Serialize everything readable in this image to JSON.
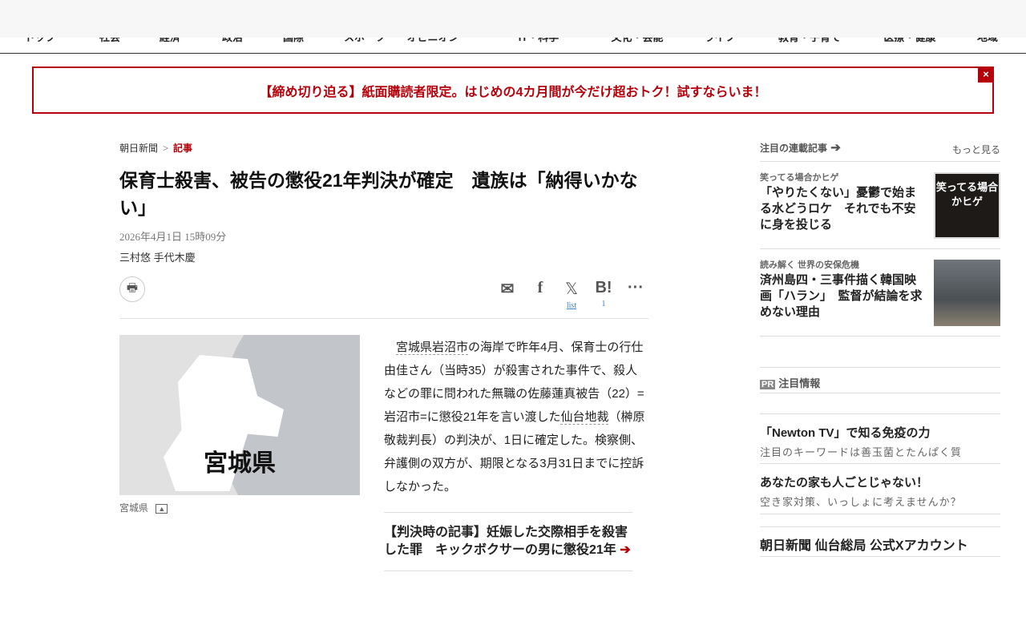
{
  "nav": [
    "トップ",
    "社会",
    "経済",
    "政治",
    "国際",
    "スポーツ",
    "オピニオン",
    "IT・科学",
    "文化・芸能",
    "ライフ",
    "教育・子育て",
    "医療・健康",
    "地域"
  ],
  "banner": {
    "text": "【締め切り迫る】紙面購読者限定。はじめの4カ月間が今だけ超おトク！試すならいま！",
    "close": "×"
  },
  "breadcrumb": {
    "home": "朝日新聞",
    "sep": ">",
    "current": "記事"
  },
  "article": {
    "title": "保育士殺害、被告の懲役21年判決が確定　遺族は「納得いかない」",
    "date": "2026年4月1日 15時09分",
    "authors": "三村悠 手代木慶",
    "share": {
      "x_count": "list",
      "hatena_count": "1"
    },
    "image_label": "宮城県",
    "caption": "宮城県",
    "body": {
      "link1": "宮城県岩沼市",
      "p1": "の海岸で昨年4月、保育士の行仕由佳さん（当時35）が殺害された事件で、殺人などの罪に問われた無職の佐藤蓮真被告（22）=岩沼市=に懲役21年を言い渡した",
      "link2": "仙台地裁",
      "p2": "（榊原敬裁判長）の判決が、1日に確定した。検察側、弁護側の双方が、期限となる3月31日までに控訴しなかった。"
    },
    "related": "【判決時の記事】妊娠した交際相手を殺害した罪　キックボクサーの男に懲役21年"
  },
  "sidebar": {
    "heading": "注目の連載記事",
    "more": "もっと見る",
    "items": [
      {
        "kicker": "笑ってる場合かヒゲ",
        "title": "「やりたくない」憂鬱で始まる水どうロケ　それでも不安に身を投じる",
        "thumb": "笑ってる場合かヒゲ"
      },
      {
        "kicker": "読み解く 世界の安保危機",
        "title": "済州島四・三事件描く韓国映画「ハラン」　監督が結論を求めない理由"
      }
    ],
    "pr_badge": "PR",
    "pr_heading": "注目情報",
    "ads": [
      {
        "title": "「Newton TV」で知る免疫の力",
        "sub": "注目のキーワードは善玉菌とたんぱく質"
      },
      {
        "title": "あなたの家も人ごとじゃない！",
        "sub": "空き家対策、いっしょに考えませんか？"
      }
    ],
    "x_account": "朝日新聞 仙台総局 公式Xアカウント"
  },
  "colors": {
    "accent": "#b5000b"
  }
}
